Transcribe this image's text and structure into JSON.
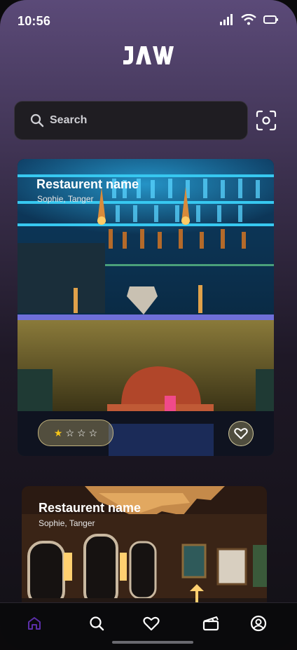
{
  "status_bar": {
    "time": "10:56"
  },
  "app": {
    "logo_name": "jaw-logo"
  },
  "search": {
    "placeholder": "Search"
  },
  "restaurants": [
    {
      "name": "Restaurent name",
      "location": "Sophie, Tanger",
      "rating": 1,
      "max_rating": 4
    },
    {
      "name": "Restaurent name",
      "location": "Sophie, Tanger"
    }
  ],
  "bottom_nav": [
    {
      "icon": "home-icon",
      "active": true
    },
    {
      "icon": "search-icon"
    },
    {
      "icon": "heart-icon"
    },
    {
      "icon": "clapperboard-icon"
    },
    {
      "icon": "profile-icon"
    }
  ],
  "colors": {
    "accent": "#5b2fa8",
    "star": "#f5c518",
    "bg_top": "#5b4a78"
  }
}
